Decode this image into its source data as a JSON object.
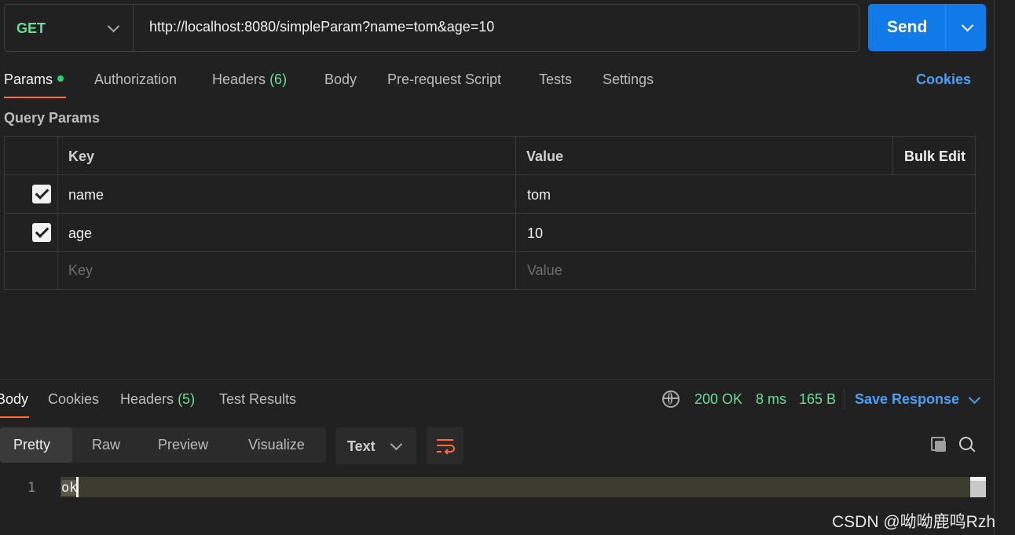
{
  "request": {
    "method": "GET",
    "url": "http://localhost:8080/simpleParam?name=tom&age=10",
    "send_label": "Send"
  },
  "request_tabs": [
    {
      "label": "Params",
      "active": true,
      "dot": true
    },
    {
      "label": "Authorization"
    },
    {
      "label": "Headers",
      "count": "(6)"
    },
    {
      "label": "Body"
    },
    {
      "label": "Pre-request Script"
    },
    {
      "label": "Tests"
    },
    {
      "label": "Settings"
    }
  ],
  "cookies_link": "Cookies",
  "query_params": {
    "title": "Query Params",
    "headers": {
      "key": "Key",
      "value": "Value",
      "bulk_edit": "Bulk Edit"
    },
    "rows": [
      {
        "checked": true,
        "key": "name",
        "value": "tom"
      },
      {
        "checked": true,
        "key": "age",
        "value": "10"
      }
    ],
    "new_row": {
      "key_placeholder": "Key",
      "value_placeholder": "Value"
    }
  },
  "response": {
    "tabs": [
      {
        "label": "Body",
        "active": true
      },
      {
        "label": "Cookies"
      },
      {
        "label": "Headers",
        "count": "(5)"
      },
      {
        "label": "Test Results"
      }
    ],
    "status": "200 OK",
    "time": "8 ms",
    "size": "165 B",
    "save_response": "Save Response",
    "view_modes": [
      "Pretty",
      "Raw",
      "Preview",
      "Visualize"
    ],
    "active_view": "Pretty",
    "format": "Text",
    "lines": [
      {
        "number": "1",
        "text": "ok"
      }
    ]
  },
  "watermark": "CSDN @呦呦鹿鸣Rzh",
  "colors": {
    "accent": "#ff6c37",
    "send": "#0f7ae8",
    "link": "#4d9ff5",
    "success": "#6bdd9a"
  },
  "icons": [
    "chevron-down-icon",
    "globe-icon",
    "wrap-lines-icon",
    "copy-icon",
    "search-icon",
    "checkbox-checked-icon"
  ]
}
